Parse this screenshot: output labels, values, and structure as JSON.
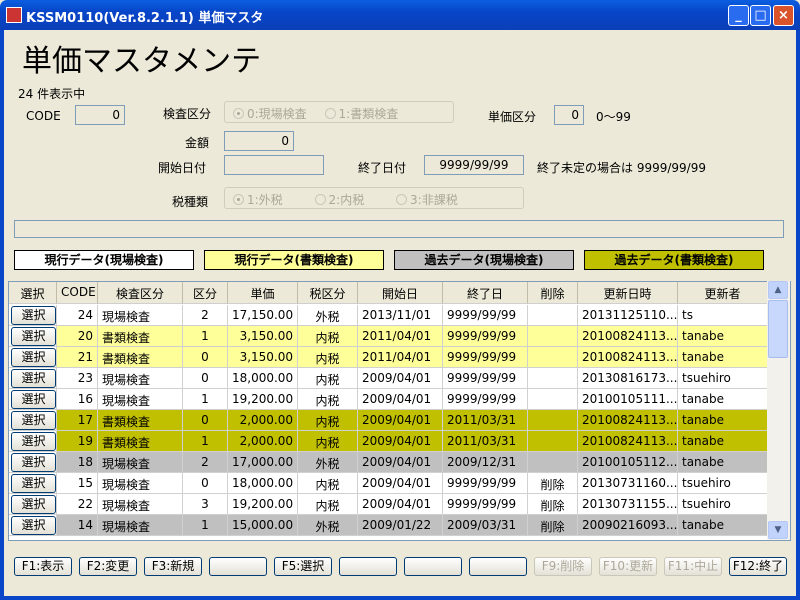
{
  "window": {
    "title": "KSSM0110(Ver.8.2.1.1) 単価マスタ",
    "minimize": "_",
    "maximize": "□",
    "close": "×"
  },
  "header": {
    "title": "単価マスタメンテ",
    "count": "24 件表示中"
  },
  "form": {
    "code_label": "CODE",
    "code_value": "0",
    "kensa_label": "検査区分",
    "kensa_options": [
      "0:現場検査",
      "1:書類検査"
    ],
    "kensa_selected": 0,
    "tanka_kubun_label": "単価区分",
    "tanka_kubun_value": "0",
    "tanka_kubun_range": "0～99",
    "kingaku_label": "金額",
    "kingaku_value": "0",
    "start_label": "開始日付",
    "start_value": "",
    "end_label": "終了日付",
    "end_value": "9999/99/99",
    "end_note": "終了未定の場合は 9999/99/99",
    "tax_label": "税種類",
    "tax_options": [
      "1:外税",
      "2:内税",
      "3:非課税"
    ],
    "tax_selected": 0
  },
  "legend": [
    {
      "label": "現行データ(現場検査)",
      "color": "#ffffff"
    },
    {
      "label": "現行データ(書類検査)",
      "color": "#ffff99"
    },
    {
      "label": "過去データ(現場検査)",
      "color": "#c0c0c0"
    },
    {
      "label": "過去データ(書類検査)",
      "color": "#c0c000"
    }
  ],
  "grid": {
    "columns": [
      "選択",
      "CODE",
      "検査区分",
      "区分",
      "単価",
      "税区分",
      "開始日",
      "終了日",
      "削除",
      "更新日時",
      "更新者"
    ],
    "select_label": "選択",
    "rows": [
      {
        "code": "24",
        "kensa": "現場検査",
        "kubun": "2",
        "tanka": "17,150.00",
        "tax": "外税",
        "start": "2013/11/01",
        "end": "9999/99/99",
        "del": "",
        "updated": "20131125110...",
        "user": "ts",
        "color": "#ffffff"
      },
      {
        "code": "20",
        "kensa": "書類検査",
        "kubun": "1",
        "tanka": "3,150.00",
        "tax": "内税",
        "start": "2011/04/01",
        "end": "9999/99/99",
        "del": "",
        "updated": "20100824113...",
        "user": "tanabe",
        "color": "#ffff99"
      },
      {
        "code": "21",
        "kensa": "書類検査",
        "kubun": "0",
        "tanka": "3,150.00",
        "tax": "内税",
        "start": "2011/04/01",
        "end": "9999/99/99",
        "del": "",
        "updated": "20100824113...",
        "user": "tanabe",
        "color": "#ffff99"
      },
      {
        "code": "23",
        "kensa": "現場検査",
        "kubun": "0",
        "tanka": "18,000.00",
        "tax": "内税",
        "start": "2009/04/01",
        "end": "9999/99/99",
        "del": "",
        "updated": "20130816173...",
        "user": "tsuehiro",
        "color": "#ffffff"
      },
      {
        "code": "16",
        "kensa": "現場検査",
        "kubun": "1",
        "tanka": "19,200.00",
        "tax": "内税",
        "start": "2009/04/01",
        "end": "9999/99/99",
        "del": "",
        "updated": "20100105111...",
        "user": "tanabe",
        "color": "#ffffff"
      },
      {
        "code": "17",
        "kensa": "書類検査",
        "kubun": "0",
        "tanka": "2,000.00",
        "tax": "内税",
        "start": "2009/04/01",
        "end": "2011/03/31",
        "del": "",
        "updated": "20100824113...",
        "user": "tanabe",
        "color": "#c0c000"
      },
      {
        "code": "19",
        "kensa": "書類検査",
        "kubun": "1",
        "tanka": "2,000.00",
        "tax": "内税",
        "start": "2009/04/01",
        "end": "2011/03/31",
        "del": "",
        "updated": "20100824113...",
        "user": "tanabe",
        "color": "#c0c000"
      },
      {
        "code": "18",
        "kensa": "現場検査",
        "kubun": "2",
        "tanka": "17,000.00",
        "tax": "外税",
        "start": "2009/04/01",
        "end": "2009/12/31",
        "del": "",
        "updated": "20100105112...",
        "user": "tanabe",
        "color": "#c0c0c0"
      },
      {
        "code": "15",
        "kensa": "現場検査",
        "kubun": "0",
        "tanka": "18,000.00",
        "tax": "内税",
        "start": "2009/04/01",
        "end": "9999/99/99",
        "del": "削除",
        "updated": "20130731160...",
        "user": "tsuehiro",
        "color": "#ffffff"
      },
      {
        "code": "22",
        "kensa": "現場検査",
        "kubun": "3",
        "tanka": "19,200.00",
        "tax": "内税",
        "start": "2009/04/01",
        "end": "9999/99/99",
        "del": "削除",
        "updated": "20130731155...",
        "user": "tsuehiro",
        "color": "#ffffff"
      },
      {
        "code": "14",
        "kensa": "現場検査",
        "kubun": "1",
        "tanka": "15,000.00",
        "tax": "外税",
        "start": "2009/01/22",
        "end": "2009/03/31",
        "del": "削除",
        "updated": "20090216093...",
        "user": "tanabe",
        "color": "#c0c0c0"
      }
    ]
  },
  "fkeys": [
    {
      "label": "F1:表示",
      "enabled": true
    },
    {
      "label": "F2:変更",
      "enabled": true
    },
    {
      "label": "F3:新規",
      "enabled": true
    },
    {
      "label": "",
      "enabled": true
    },
    {
      "label": "F5:選択",
      "enabled": true
    },
    {
      "label": "",
      "enabled": true
    },
    {
      "label": "",
      "enabled": true
    },
    {
      "label": "",
      "enabled": true
    },
    {
      "label": "F9:削除",
      "enabled": false
    },
    {
      "label": "F10:更新",
      "enabled": false
    },
    {
      "label": "F11:中止",
      "enabled": false
    },
    {
      "label": "F12:終了",
      "enabled": true
    }
  ]
}
